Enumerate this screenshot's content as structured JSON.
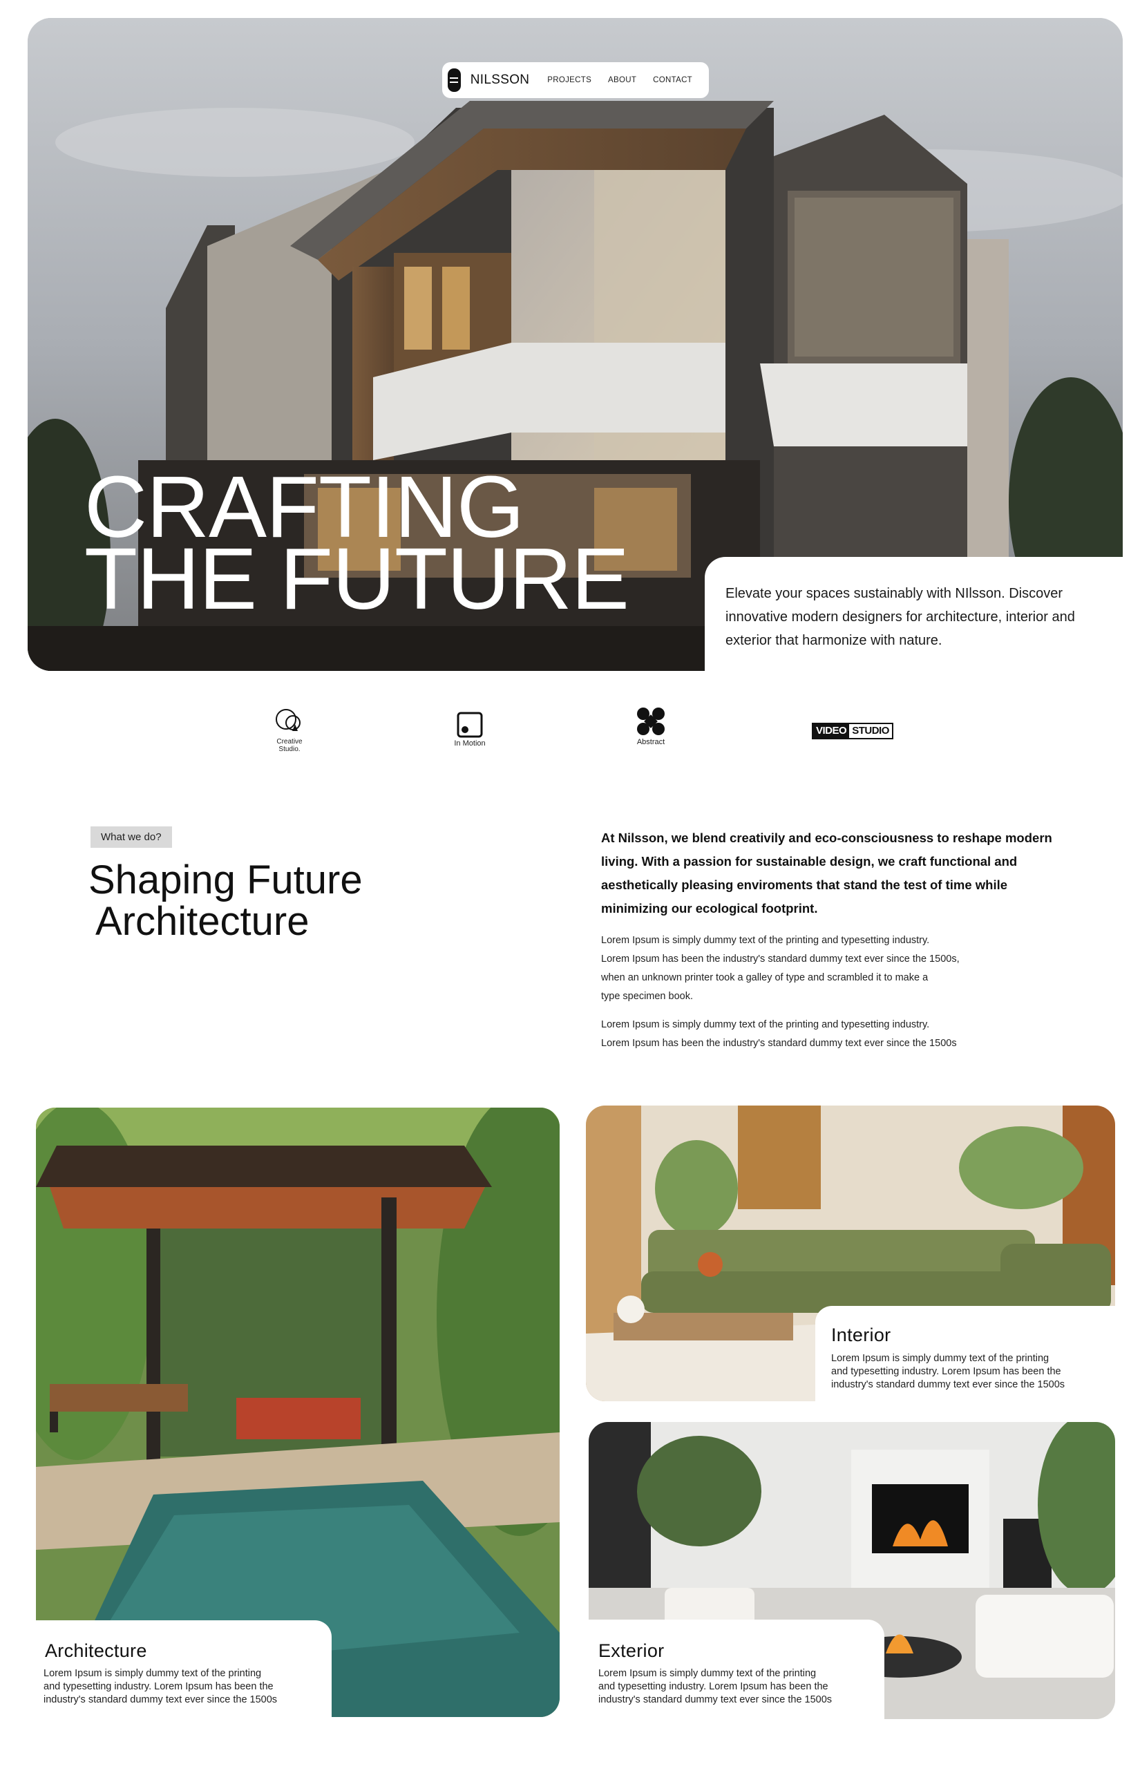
{
  "nav": {
    "brand": "NILSSON",
    "links": [
      "PROJECTS",
      "ABOUT",
      "CONTACT"
    ]
  },
  "hero": {
    "title_line1": "CRAFTING",
    "title_line2": "THE FUTURE",
    "description": "Elevate your spaces sustainably with NIlsson. Discover innovative modern designers for architecture, interior and exterior that harmonize with nature."
  },
  "partners": [
    {
      "label_line1": "Creative",
      "label_line2": "Studio.",
      "icon": "creative-studio-logo-icon"
    },
    {
      "label": "In Motion",
      "icon": "in-motion-logo-icon"
    },
    {
      "label": "Abstract",
      "icon": "abstract-logo-icon"
    },
    {
      "part1": "VIDEO",
      "part2": "STUDIO"
    }
  ],
  "about": {
    "tag": "What we do?",
    "heading_line1": "Shaping Future",
    "heading_line2": "Architecture",
    "intro": "At Nilsson, we blend creativily and eco-consciousness to reshape modern living. With a passion for sustainable design, we craft functional and aesthetically pleasing enviroments that stand the test of time while minimizing our ecological footprint.",
    "para1": [
      "Lorem Ipsum is simply dummy text of the printing and typesetting industry.",
      "Lorem Ipsum has been the industry's standard dummy text ever since the 1500s,",
      "when an unknown printer took a galley of type and scrambled it to make a",
      "type specimen book."
    ],
    "para2": [
      "Lorem Ipsum is simply dummy text of the printing and typesetting industry.",
      "Lorem Ipsum has been the industry's standard dummy text ever since the 1500s"
    ]
  },
  "services": {
    "architecture": {
      "title": "Architecture",
      "text": [
        "Lorem Ipsum is simply dummy text of the printing",
        "and typesetting industry. Lorem Ipsum has been the",
        "industry's standard dummy text ever since the 1500s"
      ]
    },
    "interior": {
      "title": "Interior",
      "text": [
        "Lorem Ipsum is simply dummy text of the printing",
        "and typesetting industry. Lorem Ipsum has been the",
        "industry's standard dummy text ever since the 1500s"
      ]
    },
    "exterior": {
      "title": "Exterior",
      "text": [
        "Lorem Ipsum is simply dummy text of the printing",
        "and typesetting industry. Lorem Ipsum has been the",
        "industry's standard dummy text ever since the 1500s"
      ]
    }
  }
}
